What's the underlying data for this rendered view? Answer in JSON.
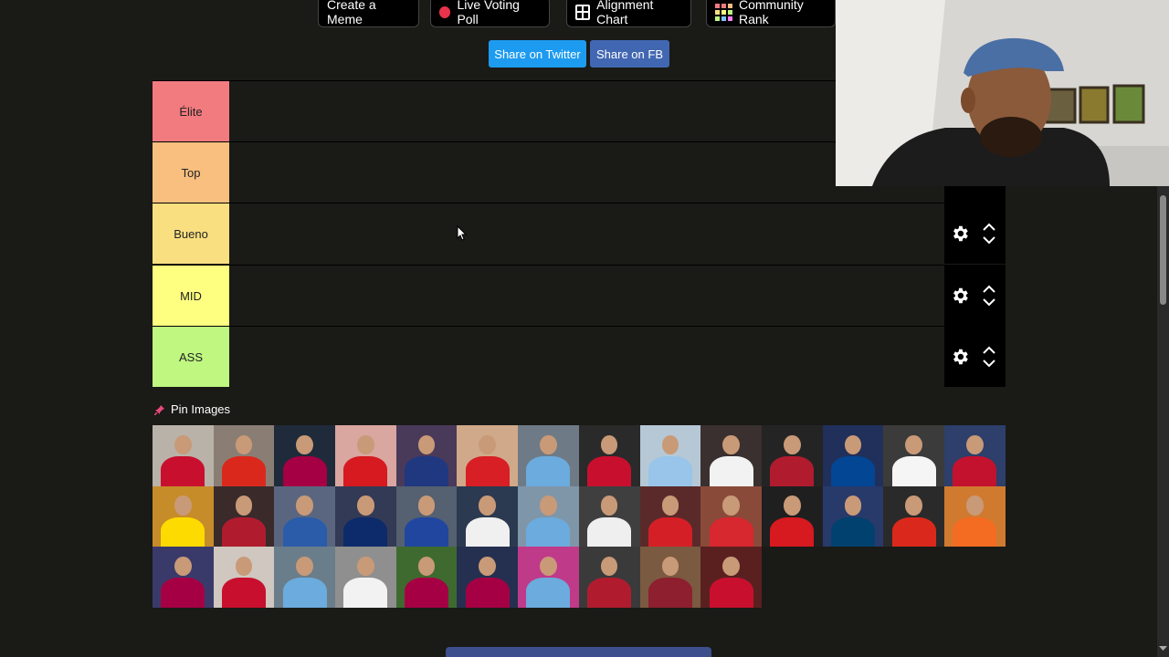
{
  "toolbar": {
    "meme_label": "Create a Meme",
    "poll_label": "Live Voting Poll",
    "alignment_label": "Alignment Chart",
    "community_label": "Community Rank"
  },
  "share": {
    "twitter_label": "Share on Twitter",
    "fb_label": "Share on FB",
    "twitter_color": "#1d9bf0",
    "fb_color": "#4267b2"
  },
  "tiers": [
    {
      "label": "Élite",
      "color": "#f27b7f"
    },
    {
      "label": "Top",
      "color": "#f8bf7f"
    },
    {
      "label": "Bueno",
      "color": "#fadf80"
    },
    {
      "label": "MID",
      "color": "#fefe80"
    },
    {
      "label": "ASS",
      "color": "#bff780"
    }
  ],
  "pin": {
    "label": "Pin Images"
  },
  "tiles": [
    {
      "bg": "#b9b2a8",
      "shirt": "#c8102e"
    },
    {
      "bg": "#8a7e74",
      "shirt": "#da291c"
    },
    {
      "bg": "#1f2b3a",
      "shirt": "#a50044"
    },
    {
      "bg": "#d9a6a0",
      "shirt": "#d71920"
    },
    {
      "bg": "#4a3a5a",
      "shirt": "#203880"
    },
    {
      "bg": "#cfa98a",
      "shirt": "#d81f26"
    },
    {
      "bg": "#6e7b86",
      "shirt": "#6cabdd"
    },
    {
      "bg": "#2a2a2a",
      "shirt": "#c8102e"
    },
    {
      "bg": "#b6c8d6",
      "shirt": "#98c5e9"
    },
    {
      "bg": "#3a3030",
      "shirt": "#f2f2f2"
    },
    {
      "bg": "#242424",
      "shirt": "#b01c2e"
    },
    {
      "bg": "#20305a",
      "shirt": "#034694"
    },
    {
      "bg": "#3b3b3b",
      "shirt": "#f5f5f5"
    },
    {
      "bg": "#2d3f6a",
      "shirt": "#c3122e"
    },
    {
      "bg": "#c68c2a",
      "shirt": "#fddb00"
    },
    {
      "bg": "#3a2a2a",
      "shirt": "#b01c2e"
    },
    {
      "bg": "#5a6680",
      "shirt": "#2a5caa"
    },
    {
      "bg": "#333a55",
      "shirt": "#0d2b6b"
    },
    {
      "bg": "#556070",
      "shirt": "#2046a0"
    },
    {
      "bg": "#2b3a50",
      "shirt": "#f0f0f0"
    },
    {
      "bg": "#7f96a8",
      "shirt": "#6cabdd"
    },
    {
      "bg": "#3f3f3f",
      "shirt": "#efefef"
    },
    {
      "bg": "#5a2a2a",
      "shirt": "#d51f26"
    },
    {
      "bg": "#8a4a3a",
      "shirt": "#d7282f"
    },
    {
      "bg": "#1f1f1f",
      "shirt": "#d71920"
    },
    {
      "bg": "#283a6a",
      "shirt": "#004170"
    },
    {
      "bg": "#2a2a2a",
      "shirt": "#da291c"
    },
    {
      "bg": "#d07a30",
      "shirt": "#f36c21"
    },
    {
      "bg": "#3a3a6a",
      "shirt": "#a50044"
    },
    {
      "bg": "#cfc7c0",
      "shirt": "#c8102e"
    },
    {
      "bg": "#6a7d8a",
      "shirt": "#6cabdd"
    },
    {
      "bg": "#8f8f8f",
      "shirt": "#f2f2f2"
    },
    {
      "bg": "#3f6a2f",
      "shirt": "#a50044"
    },
    {
      "bg": "#253050",
      "shirt": "#a50044"
    },
    {
      "bg": "#c03a8a",
      "shirt": "#6cabdd"
    },
    {
      "bg": "#3a3a3a",
      "shirt": "#b01c2e"
    },
    {
      "bg": "#7a5a40",
      "shirt": "#8e1f2f"
    },
    {
      "bg": "#5a2020",
      "shirt": "#c8102e"
    }
  ]
}
